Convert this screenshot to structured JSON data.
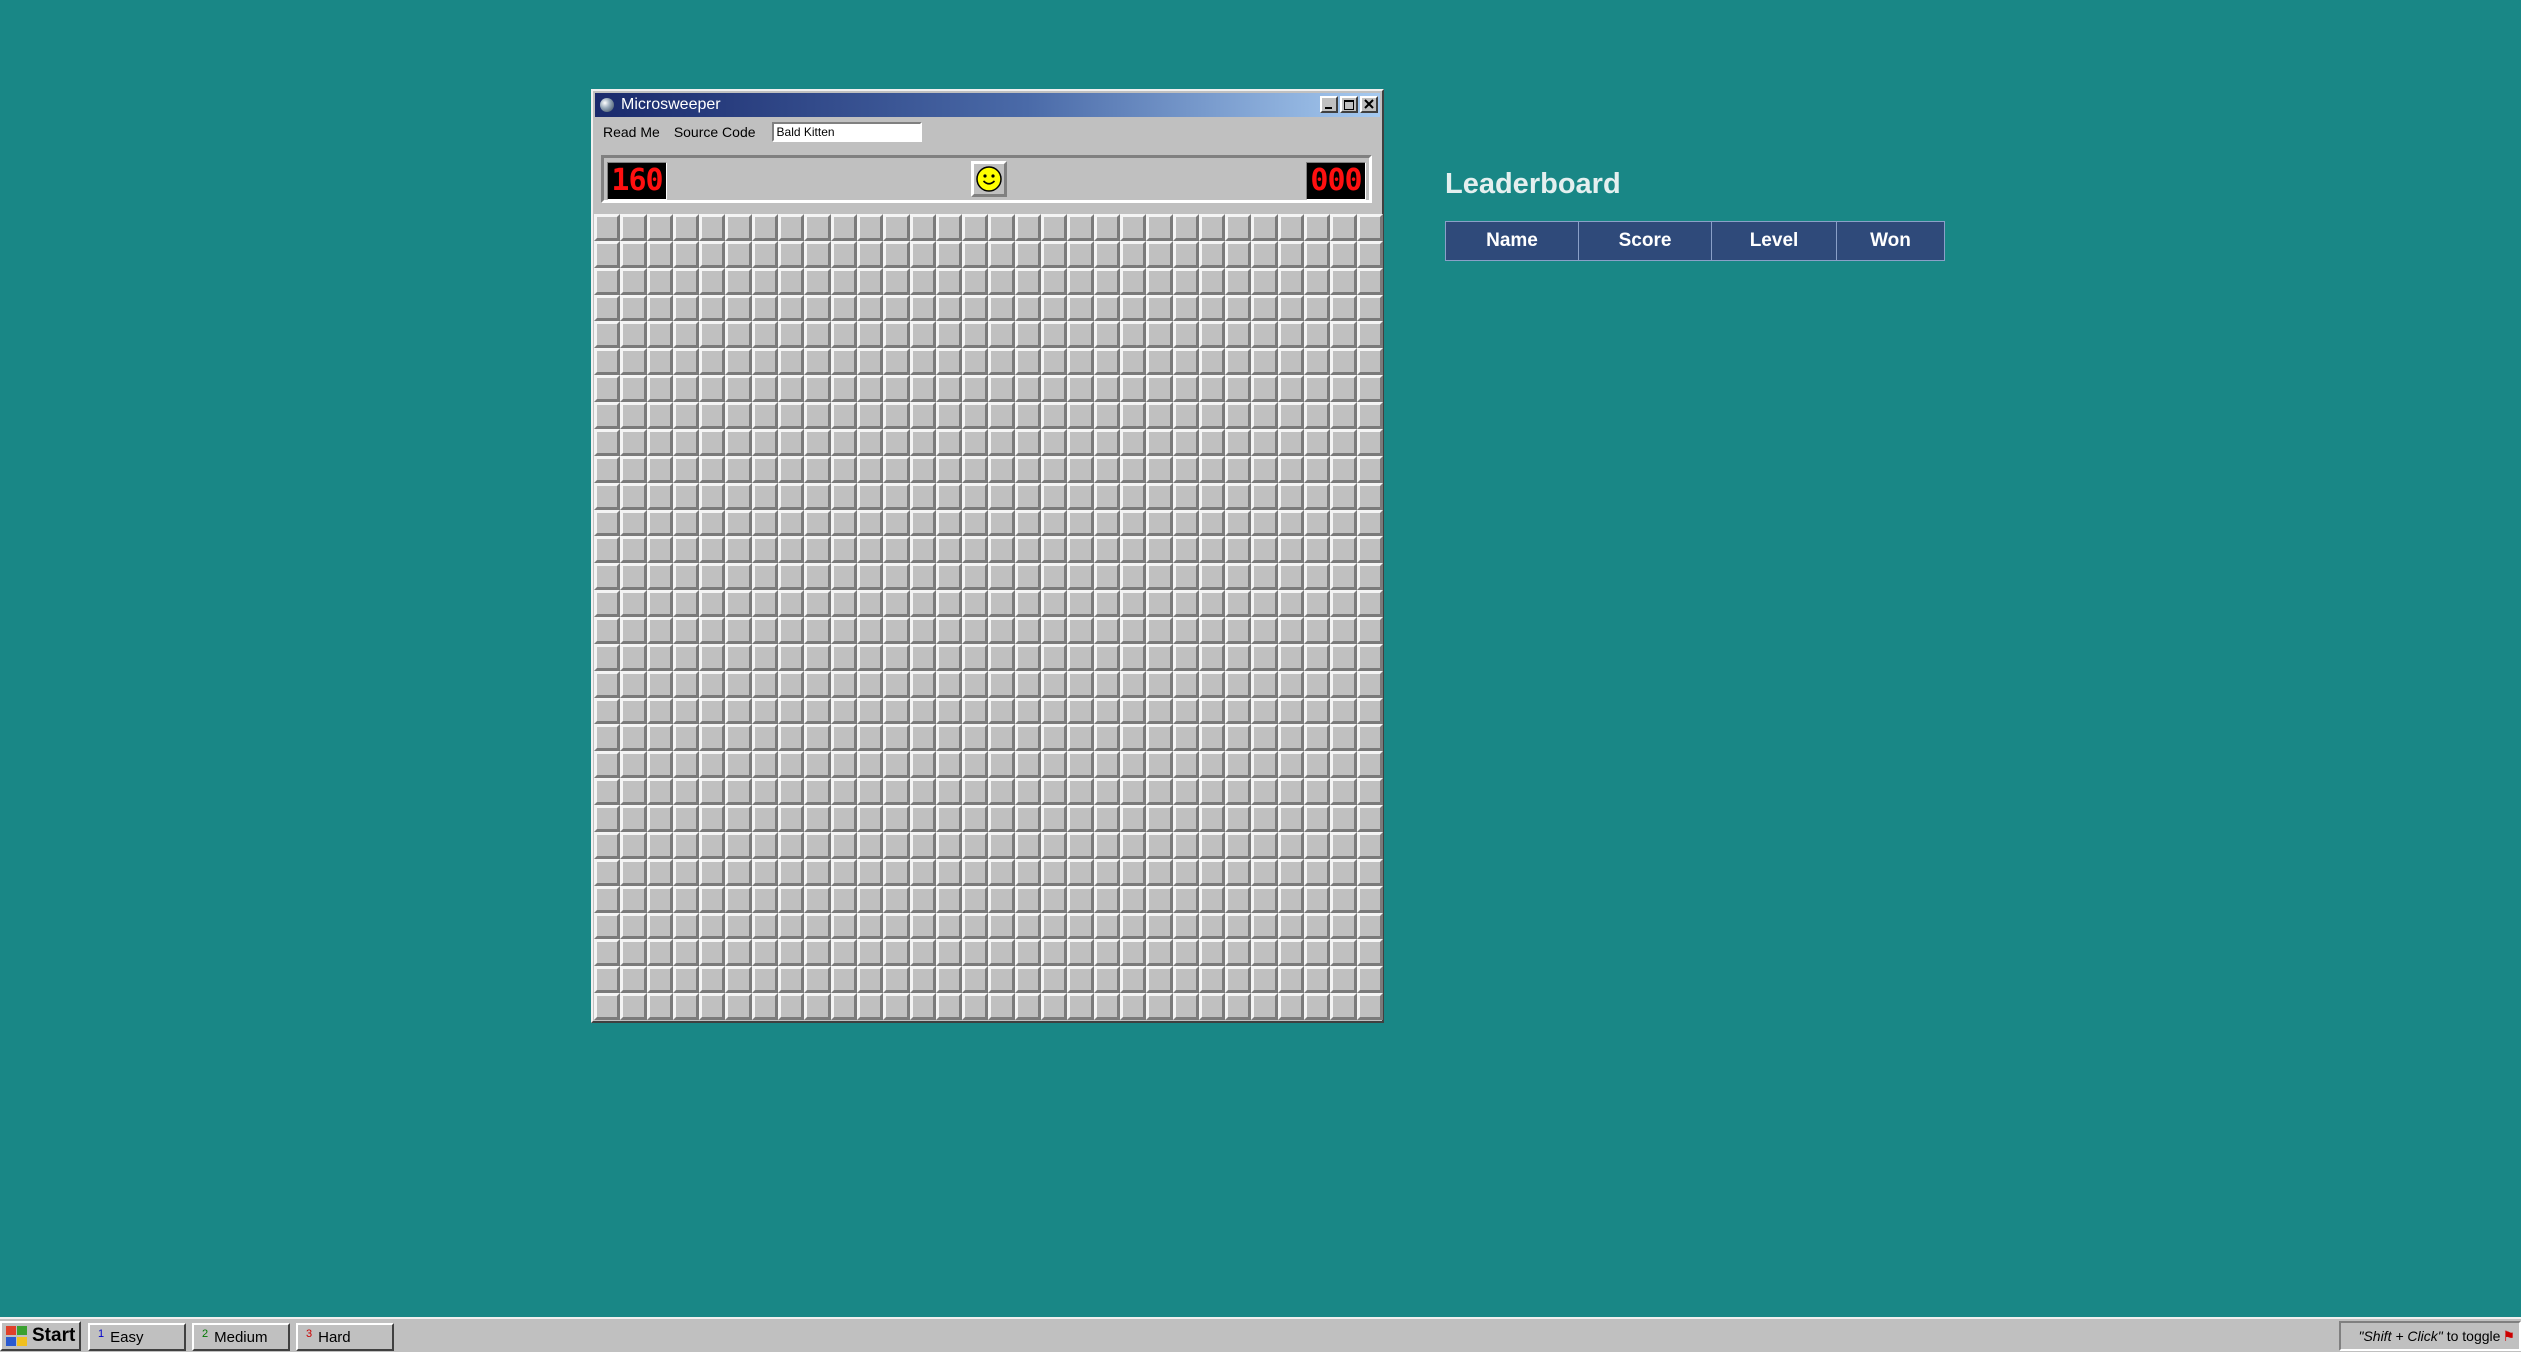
{
  "window": {
    "title": "Microsweeper",
    "menu": {
      "read_me": "Read Me",
      "source_code": "Source Code"
    },
    "name_input": {
      "value": "Bald Kitten",
      "placeholder": ""
    },
    "mine_counter": "160",
    "timer": "000",
    "face": "smiley-face",
    "grid": {
      "rows": 30,
      "cols": 30,
      "state": "all-covered"
    }
  },
  "leaderboard": {
    "title": "Leaderboard",
    "columns": [
      "Name",
      "Score",
      "Level",
      "Won"
    ],
    "rows": []
  },
  "taskbar": {
    "start_label": "Start",
    "buttons": [
      {
        "num": "1",
        "label": "Easy",
        "num_color": "#0000cc"
      },
      {
        "num": "2",
        "label": "Medium",
        "num_color": "#007700"
      },
      {
        "num": "3",
        "label": "Hard",
        "num_color": "#cc0000"
      }
    ],
    "tray": {
      "hint_emph": "\"Shift + Click\"",
      "hint_rest": "to toggle"
    }
  },
  "colors": {
    "desktop": "#198786",
    "window_face": "#c0c0c0",
    "lcd_red": "#ff1010",
    "leaderboard_header": "#2f4a7a"
  }
}
